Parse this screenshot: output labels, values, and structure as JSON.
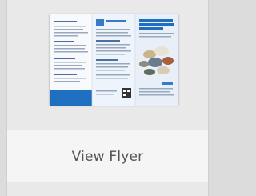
{
  "flyer_card": {
    "link_label": "View Flyer",
    "thumbnail_icon": "brochure-thumbnail",
    "colors": {
      "accent_blue": "#1f6fc1",
      "caption_text": "#555555"
    }
  }
}
